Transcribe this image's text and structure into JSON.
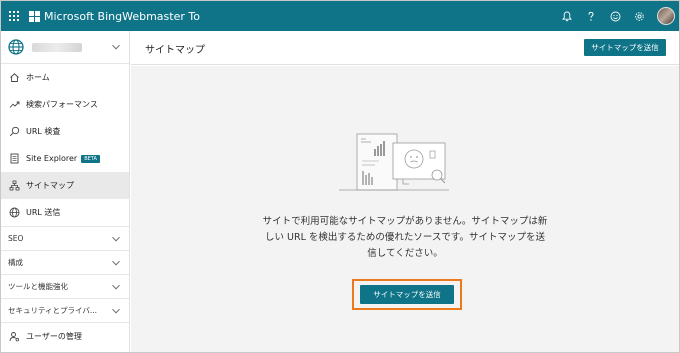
{
  "app": {
    "title": "Microsoft BingWebmaster To"
  },
  "topbar": {
    "icons": [
      "bell-icon",
      "help-icon",
      "smiley-icon",
      "gear-icon",
      "avatar"
    ]
  },
  "sidebar": {
    "site_selector": {
      "icon": "globe-icon",
      "chevron": "chevron-down-icon"
    },
    "items": [
      {
        "label": "ホーム",
        "icon": "home-icon"
      },
      {
        "label": "検索パフォーマンス",
        "icon": "trend-icon"
      },
      {
        "label": "URL 検査",
        "icon": "search-icon"
      },
      {
        "label": "Site Explorer",
        "icon": "document-icon",
        "badge": "BETA"
      },
      {
        "label": "サイトマップ",
        "icon": "sitemap-icon",
        "active": true
      },
      {
        "label": "URL 送信",
        "icon": "globe-icon"
      }
    ],
    "groups": [
      {
        "label": "SEO"
      },
      {
        "label": "構成"
      },
      {
        "label": "ツールと機能強化"
      },
      {
        "label": "セキュリティとプライバ..."
      }
    ],
    "user_management": {
      "label": "ユーザーの管理",
      "icon": "user-settings-icon"
    }
  },
  "main": {
    "title": "サイトマップ",
    "header_button": "サイトマップを送信",
    "empty_message": "サイトで利用可能なサイトマップがありません。サイトマップは新しい URL を検出するための優れたソースです。サイトマップを送信してください。",
    "center_button": "サイトマップを送信"
  },
  "colors": {
    "accent": "#0f7488",
    "highlight": "#ec7a1c",
    "background": "#f3f3f3"
  }
}
